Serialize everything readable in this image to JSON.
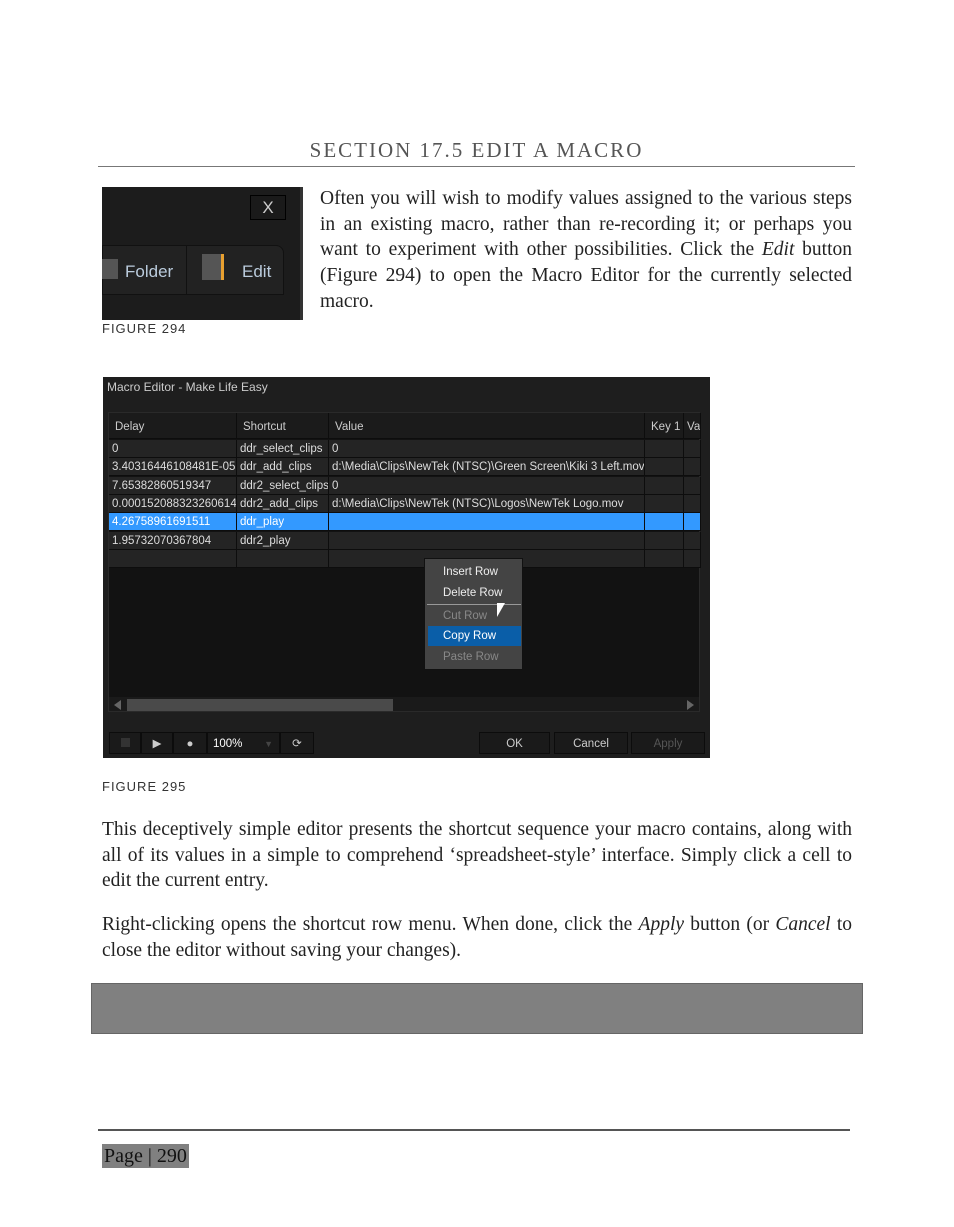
{
  "heading": "SECTION 17.5 EDIT A MACRO",
  "figure294": {
    "close_label": "X",
    "folder_label": "Folder",
    "edit_label": "Edit",
    "caption": "FIGURE 294"
  },
  "intro": {
    "before": "Often you will wish to modify values assigned to the various steps in an existing macro, rather than re-recording it; or perhaps you want to experiment with other possibilities. Click the ",
    "em": "Edit",
    "after": " button (Figure 294) to open the Macro Editor for the currently selected macro."
  },
  "editor": {
    "title": "Macro Editor - Make Life Easy",
    "columns": [
      "Delay",
      "Shortcut",
      "Value",
      "Key 1",
      "Va"
    ],
    "rows": [
      [
        "0",
        "ddr_select_clips",
        "0"
      ],
      [
        "3.40316446108481E-05",
        "ddr_add_clips",
        "d:\\Media\\Clips\\NewTek (NTSC)\\Green Screen\\Kiki 3 Left.mov"
      ],
      [
        "7.65382860519347",
        "ddr2_select_clips",
        "0"
      ],
      [
        "0.000152088323260614",
        "ddr2_add_clips",
        "d:\\Media\\Clips\\NewTek (NTSC)\\Logos\\NewTek Logo.mov"
      ],
      [
        "4.26758961691511",
        "ddr_play",
        ""
      ],
      [
        "1.95732070367804",
        "ddr2_play",
        ""
      ]
    ],
    "selected_row": 4,
    "context_menu": [
      {
        "label": "Insert Row",
        "enabled": true
      },
      {
        "label": "Delete Row",
        "enabled": true
      },
      {
        "label": "Cut Row",
        "enabled": false
      },
      {
        "label": "Copy Row",
        "enabled": true,
        "highlighted": true
      },
      {
        "label": "Paste Row",
        "enabled": false
      }
    ],
    "speed": "100%",
    "ok": "OK",
    "cancel": "Cancel",
    "apply": "Apply",
    "colors": {
      "selection": "#3399ff",
      "menu_highlight": "#0a5ea8"
    }
  },
  "caption295": "FIGURE 295",
  "para1": "This deceptively simple editor presents the shortcut sequence your macro contains, along with all of its values in a simple to comprehend ‘spreadsheet-style’ interface. Simply click a cell to edit the current entry.",
  "para2": {
    "a": "Right-clicking opens the shortcut row menu. When done, click the ",
    "em1": "Apply",
    "b": " button (or ",
    "em2": "Cancel",
    "c": " to close the editor without saving your changes)."
  },
  "footer": {
    "page": "Page | 290"
  }
}
